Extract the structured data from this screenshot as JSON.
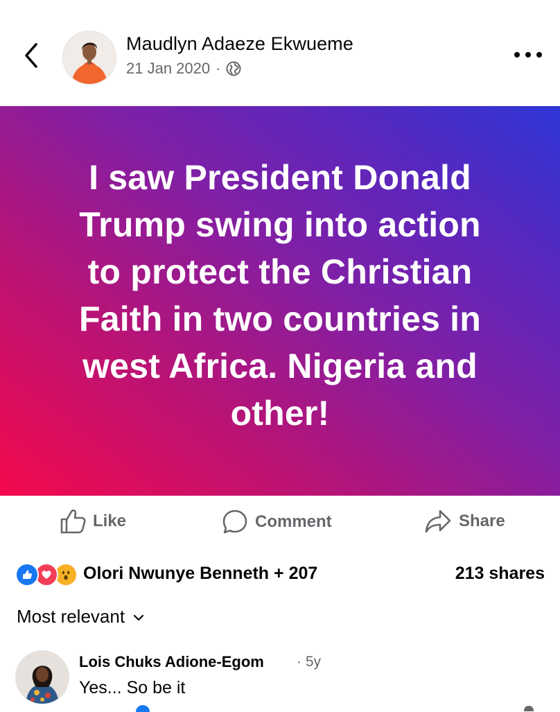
{
  "post": {
    "author": "Maudlyn Adaeze Ekwueme",
    "date": "21 Jan 2020",
    "separator": "·",
    "text": "I saw President Donald\nTrump swing into action\nto protect  the Christian\nFaith in two countries in\nwest Africa. Nigeria and\nother!",
    "gradient_colors": [
      "#f4094c",
      "#b51478",
      "#7e20a7",
      "#5a27bd",
      "#2e36d6"
    ]
  },
  "icons": {
    "back": "chevron-left-icon",
    "more": "more-horizontal-icon",
    "privacy": "globe-icon",
    "like": "thumbs-up-icon",
    "comment": "speech-bubble-icon",
    "share": "share-arrow-icon"
  },
  "actions": {
    "like": "Like",
    "comment": "Comment",
    "share": "Share"
  },
  "reactions": {
    "types": [
      "like",
      "love",
      "wow"
    ],
    "reactors": "Olori Nwunye Benneth + 207",
    "shares": "213 shares"
  },
  "comments": {
    "sort_label": "Most relevant",
    "items": [
      {
        "author": "Lois Chuks Adione-Egom",
        "time": "· 5y",
        "text": "Yes... So be it"
      }
    ]
  },
  "colors": {
    "text_primary": "#050505",
    "text_secondary": "#65676b",
    "like_blue": "#1877f2",
    "love_red": "#f33e58",
    "wow_yellow": "#f7b125"
  }
}
